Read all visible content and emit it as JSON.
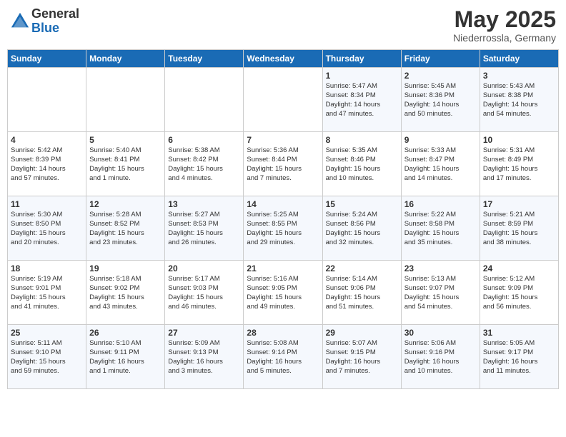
{
  "header": {
    "logo_general": "General",
    "logo_blue": "Blue",
    "month_title": "May 2025",
    "subtitle": "Niederrossla, Germany"
  },
  "days_of_week": [
    "Sunday",
    "Monday",
    "Tuesday",
    "Wednesday",
    "Thursday",
    "Friday",
    "Saturday"
  ],
  "weeks": [
    [
      {
        "day": "",
        "content": ""
      },
      {
        "day": "",
        "content": ""
      },
      {
        "day": "",
        "content": ""
      },
      {
        "day": "",
        "content": ""
      },
      {
        "day": "1",
        "content": "Sunrise: 5:47 AM\nSunset: 8:34 PM\nDaylight: 14 hours\nand 47 minutes."
      },
      {
        "day": "2",
        "content": "Sunrise: 5:45 AM\nSunset: 8:36 PM\nDaylight: 14 hours\nand 50 minutes."
      },
      {
        "day": "3",
        "content": "Sunrise: 5:43 AM\nSunset: 8:38 PM\nDaylight: 14 hours\nand 54 minutes."
      }
    ],
    [
      {
        "day": "4",
        "content": "Sunrise: 5:42 AM\nSunset: 8:39 PM\nDaylight: 14 hours\nand 57 minutes."
      },
      {
        "day": "5",
        "content": "Sunrise: 5:40 AM\nSunset: 8:41 PM\nDaylight: 15 hours\nand 1 minute."
      },
      {
        "day": "6",
        "content": "Sunrise: 5:38 AM\nSunset: 8:42 PM\nDaylight: 15 hours\nand 4 minutes."
      },
      {
        "day": "7",
        "content": "Sunrise: 5:36 AM\nSunset: 8:44 PM\nDaylight: 15 hours\nand 7 minutes."
      },
      {
        "day": "8",
        "content": "Sunrise: 5:35 AM\nSunset: 8:46 PM\nDaylight: 15 hours\nand 10 minutes."
      },
      {
        "day": "9",
        "content": "Sunrise: 5:33 AM\nSunset: 8:47 PM\nDaylight: 15 hours\nand 14 minutes."
      },
      {
        "day": "10",
        "content": "Sunrise: 5:31 AM\nSunset: 8:49 PM\nDaylight: 15 hours\nand 17 minutes."
      }
    ],
    [
      {
        "day": "11",
        "content": "Sunrise: 5:30 AM\nSunset: 8:50 PM\nDaylight: 15 hours\nand 20 minutes."
      },
      {
        "day": "12",
        "content": "Sunrise: 5:28 AM\nSunset: 8:52 PM\nDaylight: 15 hours\nand 23 minutes."
      },
      {
        "day": "13",
        "content": "Sunrise: 5:27 AM\nSunset: 8:53 PM\nDaylight: 15 hours\nand 26 minutes."
      },
      {
        "day": "14",
        "content": "Sunrise: 5:25 AM\nSunset: 8:55 PM\nDaylight: 15 hours\nand 29 minutes."
      },
      {
        "day": "15",
        "content": "Sunrise: 5:24 AM\nSunset: 8:56 PM\nDaylight: 15 hours\nand 32 minutes."
      },
      {
        "day": "16",
        "content": "Sunrise: 5:22 AM\nSunset: 8:58 PM\nDaylight: 15 hours\nand 35 minutes."
      },
      {
        "day": "17",
        "content": "Sunrise: 5:21 AM\nSunset: 8:59 PM\nDaylight: 15 hours\nand 38 minutes."
      }
    ],
    [
      {
        "day": "18",
        "content": "Sunrise: 5:19 AM\nSunset: 9:01 PM\nDaylight: 15 hours\nand 41 minutes."
      },
      {
        "day": "19",
        "content": "Sunrise: 5:18 AM\nSunset: 9:02 PM\nDaylight: 15 hours\nand 43 minutes."
      },
      {
        "day": "20",
        "content": "Sunrise: 5:17 AM\nSunset: 9:03 PM\nDaylight: 15 hours\nand 46 minutes."
      },
      {
        "day": "21",
        "content": "Sunrise: 5:16 AM\nSunset: 9:05 PM\nDaylight: 15 hours\nand 49 minutes."
      },
      {
        "day": "22",
        "content": "Sunrise: 5:14 AM\nSunset: 9:06 PM\nDaylight: 15 hours\nand 51 minutes."
      },
      {
        "day": "23",
        "content": "Sunrise: 5:13 AM\nSunset: 9:07 PM\nDaylight: 15 hours\nand 54 minutes."
      },
      {
        "day": "24",
        "content": "Sunrise: 5:12 AM\nSunset: 9:09 PM\nDaylight: 15 hours\nand 56 minutes."
      }
    ],
    [
      {
        "day": "25",
        "content": "Sunrise: 5:11 AM\nSunset: 9:10 PM\nDaylight: 15 hours\nand 59 minutes."
      },
      {
        "day": "26",
        "content": "Sunrise: 5:10 AM\nSunset: 9:11 PM\nDaylight: 16 hours\nand 1 minute."
      },
      {
        "day": "27",
        "content": "Sunrise: 5:09 AM\nSunset: 9:13 PM\nDaylight: 16 hours\nand 3 minutes."
      },
      {
        "day": "28",
        "content": "Sunrise: 5:08 AM\nSunset: 9:14 PM\nDaylight: 16 hours\nand 5 minutes."
      },
      {
        "day": "29",
        "content": "Sunrise: 5:07 AM\nSunset: 9:15 PM\nDaylight: 16 hours\nand 7 minutes."
      },
      {
        "day": "30",
        "content": "Sunrise: 5:06 AM\nSunset: 9:16 PM\nDaylight: 16 hours\nand 10 minutes."
      },
      {
        "day": "31",
        "content": "Sunrise: 5:05 AM\nSunset: 9:17 PM\nDaylight: 16 hours\nand 11 minutes."
      }
    ]
  ]
}
